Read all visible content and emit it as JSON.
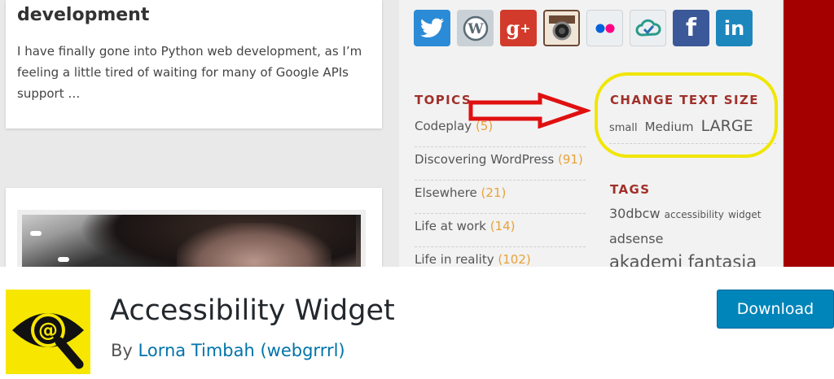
{
  "banner": {
    "post": {
      "title": "development",
      "excerpt": "I have finally gone into Python web development, as I’m feeling a little tired of waiting for many of Google APIs support …"
    },
    "social_icons": [
      {
        "name": "twitter-icon",
        "color": "#2b8bd6",
        "glyph": "🐦"
      },
      {
        "name": "wordpress-icon",
        "color": "#c9d1d6",
        "glyph": "W"
      },
      {
        "name": "google-plus-icon",
        "color": "#d23b2b",
        "glyph": "g+"
      },
      {
        "name": "instagram-icon",
        "color": "#6b4a36",
        "glyph": "◉"
      },
      {
        "name": "flickr-icon",
        "color": "#e6e6e6",
        "glyph": "••"
      },
      {
        "name": "cloud-icon",
        "color": "#e6e6e6",
        "glyph": "☁"
      },
      {
        "name": "facebook-icon",
        "color": "#3b5998",
        "glyph": "f"
      },
      {
        "name": "linkedin-icon",
        "color": "#1d87bd",
        "glyph": "in"
      }
    ],
    "topics": {
      "title": "TOPICS",
      "items": [
        {
          "label": "Codeplay",
          "count": "(5)"
        },
        {
          "label": "Discovering WordPress",
          "count": "(91)"
        },
        {
          "label": "Elsewhere",
          "count": "(21)"
        },
        {
          "label": "Life at work",
          "count": "(14)"
        },
        {
          "label": "Life in reality",
          "count": "(102)"
        }
      ]
    },
    "text_size": {
      "title": "CHANGE TEXT SIZE",
      "small": "small",
      "medium": "Medium",
      "large": "LARGE"
    },
    "tags": {
      "title": "TAGS",
      "items": [
        "30dbcw",
        "accessibility",
        "widget",
        "adsense",
        "akademi fantasia"
      ]
    },
    "colors": {
      "highlight": "#f0e600",
      "arrow": "#e01010",
      "widget_title": "#a0302a",
      "count": "#e8a23a"
    }
  },
  "plugin": {
    "name": "Accessibility Widget",
    "by": "By",
    "author": "Lorna Timbah (webgrrrl)",
    "download_label": "Download",
    "logo_icon": "eye-at-magnifier-icon",
    "colors": {
      "logo_bg": "#f7e600",
      "button": "#0085ba",
      "link": "#0073aa"
    }
  }
}
